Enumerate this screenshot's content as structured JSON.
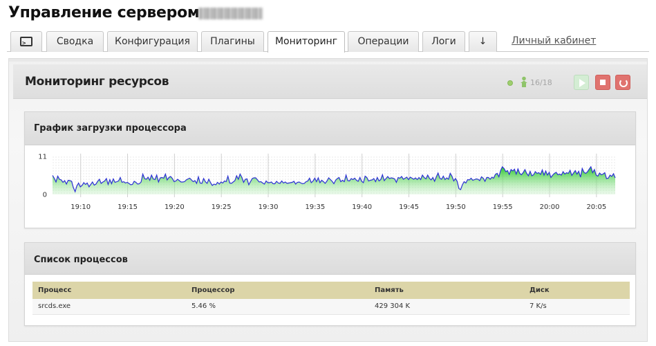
{
  "page": {
    "title": "Управление сервером"
  },
  "tabs": [
    {
      "label": "",
      "icon": "console-icon"
    },
    {
      "label": "Сводка"
    },
    {
      "label": "Конфигурация"
    },
    {
      "label": "Плагины"
    },
    {
      "label": "Мониторинг",
      "active": true
    },
    {
      "label": "Операции"
    },
    {
      "label": "Логи"
    },
    {
      "label": "↓"
    }
  ],
  "cabinet_link": "Личный кабинет",
  "monitoring": {
    "title": "Мониторинг ресурсов",
    "status_color": "#9fcf6e",
    "players": "16/18",
    "controls": [
      "play-icon",
      "stop-icon",
      "restart-icon"
    ]
  },
  "cpu_panel": {
    "title": "График загрузки процессора"
  },
  "chart_data": {
    "type": "area",
    "title": "",
    "xlabel": "",
    "ylabel": "",
    "ylim": [
      0,
      11
    ],
    "y_ticks": [
      "11",
      "0"
    ],
    "x_ticks": [
      "19:10",
      "19:15",
      "19:20",
      "19:25",
      "19:30",
      "19:35",
      "19:40",
      "19:45",
      "19:50",
      "19:55",
      "20:00",
      "20:05"
    ],
    "x_start": "19:07",
    "x_end": "20:07",
    "line_color": "#2b2fd6",
    "fill_color": "#2ecc2e",
    "values": [
      5.5,
      4.7,
      3.6,
      5.3,
      4.4,
      4.2,
      3.5,
      4.0,
      3.0,
      4.1,
      4.0,
      3.8,
      2.0,
      0.8,
      2.5,
      3.3,
      2.2,
      2.6,
      3.4,
      2.9,
      3.3,
      2.2,
      2.9,
      3.6,
      2.7,
      3.0,
      3.8,
      4.4,
      3.2,
      3.6,
      3.9,
      4.6,
      2.9,
      4.3,
      3.1,
      4.5,
      3.5,
      3.7,
      3.9,
      4.9,
      3.5,
      3.7,
      3.3,
      3.5,
      3.2,
      2.8,
      2.9,
      3.8,
      3.5,
      3.0,
      3.1,
      3.6,
      5.9,
      4.6,
      4.4,
      5.0,
      4.1,
      5.6,
      4.5,
      4.3,
      5.6,
      3.6,
      4.8,
      4.9,
      4.7,
      5.9,
      4.2,
      4.9,
      5.2,
      4.6,
      3.7,
      3.9,
      4.4,
      4.0,
      3.6,
      3.6,
      3.7,
      4.2,
      4.5,
      4.7,
      4.2,
      3.7,
      4.0,
      3.2,
      5.1,
      3.3,
      3.2,
      4.6,
      3.7,
      3.2,
      4.4,
      3.4,
      2.6,
      3.0,
      2.8,
      3.5,
      3.0,
      3.6,
      3.3,
      3.9,
      3.7,
      5.3,
      3.3,
      3.2,
      3.6,
      4.0,
      5.4,
      4.4,
      5.9,
      5.0,
      3.5,
      4.4,
      4.5,
      2.8,
      3.7,
      4.6,
      4.8,
      4.8,
      4.2,
      3.6,
      3.7,
      3.3,
      3.0,
      3.9,
      3.4,
      3.4,
      3.6,
      3.1,
      3.1,
      3.8,
      3.3,
      3.2,
      3.9,
      3.3,
      3.6,
      3.2,
      3.3,
      3.4,
      3.5,
      3.8,
      3.0,
      3.5,
      3.6,
      3.3,
      3.1,
      3.2,
      3.7,
      3.9,
      4.7,
      3.4,
      3.9,
      4.7,
      3.7,
      4.8,
      3.4,
      4.1,
      3.7,
      3.2,
      3.9,
      4.8,
      4.3,
      3.8,
      3.1,
      4.1,
      4.6,
      4.9,
      3.7,
      4.1,
      3.7,
      5.6,
      4.0,
      3.9,
      4.6,
      4.3,
      4.7,
      4.1,
      3.8,
      4.9,
      3.8,
      3.4,
      5.3,
      4.9,
      3.9,
      4.1,
      4.2,
      4.6,
      3.7,
      4.9,
      3.9,
      4.3,
      5.7,
      4.0,
      4.6,
      5.2,
      4.6,
      4.8,
      4.7,
      4.5,
      3.5,
      4.9,
      4.7,
      5.2,
      4.4,
      4.7,
      5.0,
      4.3,
      5.0,
      4.7,
      4.4,
      4.8,
      4.3,
      4.9,
      4.3,
      5.6,
      4.9,
      4.5,
      5.6,
      4.7,
      4.2,
      4.9,
      3.8,
      5.1,
      6.2,
      4.7,
      4.4,
      5.3,
      4.3,
      4.8,
      4.4,
      6.1,
      5.3,
      3.9,
      4.6,
      3.8,
      1.7,
      1.4,
      2.8,
      3.7,
      3.3,
      4.3,
      4.2,
      4.7,
      4.1,
      4.3,
      4.5,
      4.4,
      4.0,
      5.1,
      4.7,
      3.8,
      4.9,
      4.9,
      4.4,
      5.0,
      4.7,
      5.8,
      6.1,
      5.1,
      6.9,
      8.0,
      7.5,
      6.6,
      6.9,
      5.8,
      7.2,
      6.8,
      7.3,
      5.9,
      7.4,
      6.1,
      5.7,
      6.3,
      7.2,
      6.1,
      5.4,
      6.7,
      5.4,
      5.7,
      6.6,
      6.1,
      6.3,
      5.8,
      7.1,
      5.6,
      6.8,
      5.6,
      6.4,
      4.9,
      5.6,
      6.1,
      6.4,
      5.7,
      5.9,
      5.6,
      6.6,
      5.9,
      6.3,
      6.1,
      7.0,
      5.5,
      6.2,
      6.9,
      5.9,
      6.7,
      5.0,
      7.5,
      6.4,
      6.1,
      6.5,
      7.3,
      8.0,
      6.3,
      7.2,
      5.6,
      5.3,
      6.2,
      5.7,
      5.9,
      6.3,
      4.6,
      4.7,
      5.6,
      5.2,
      6.0,
      4.8
    ]
  },
  "process_panel": {
    "title": "Список процессов",
    "columns": [
      "Процесс",
      "Процессор",
      "Память",
      "Диск"
    ],
    "rows": [
      {
        "process": "srcds.exe",
        "cpu": "5.46 %",
        "memory": "429 304 K",
        "disk": "7 K/s"
      }
    ]
  }
}
